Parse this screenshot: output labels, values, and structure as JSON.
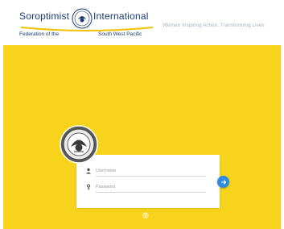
{
  "header": {
    "logo": {
      "line1_left": "Soroptimist",
      "line1_right": "International",
      "line2_left": "Federation of the",
      "line2_right": "South West Pacific"
    },
    "tagline": "Women Inspiring Action. Transforming Lives"
  },
  "login": {
    "emblem_icon": "soroptimist-emblem-icon",
    "username_placeholder": "Username",
    "password_placeholder": "Password",
    "user_icon": "person-icon",
    "password_icon": "key-icon",
    "submit_icon": "arrow-right-icon"
  },
  "colors": {
    "brand_yellow": "#f8d31b",
    "brand_blue": "#1c3b73",
    "accent_blue": "#2f8be0"
  }
}
